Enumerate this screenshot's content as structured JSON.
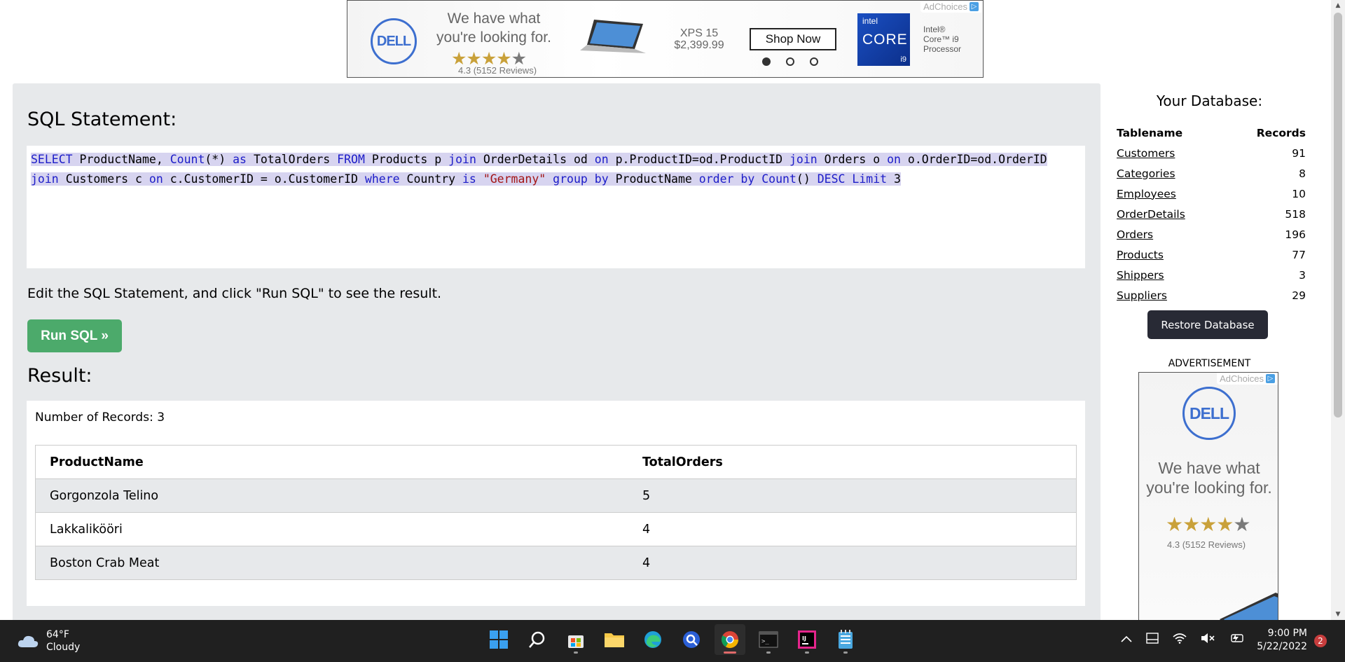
{
  "top_ad": {
    "brand": "DELL",
    "tagline_1": "We have what",
    "tagline_2": "you're looking for.",
    "rating": "4.3",
    "reviews": "(5152 Reviews)",
    "product": "XPS 15",
    "price": "$2,399.99",
    "cta": "Shop Now",
    "intel_brand": "intel",
    "intel_core": "CORE",
    "intel_tier": "i9",
    "intel_text_1": "Intel®",
    "intel_text_2": "Core™ i9",
    "intel_text_3": "Processor",
    "adchoices": "AdChoices",
    "carousel_active_index": 0,
    "carousel_count": 3
  },
  "sql_section": {
    "heading": "SQL Statement:",
    "statement": "SELECT ProductName, Count(*) as TotalOrders FROM Products p join OrderDetails od on p.ProductID=od.ProductID join Orders o on o.OrderID=od.OrderID join Customers c on c.CustomerID = o.CustomerID where Country is \"Germany\" group by ProductName order by Count() DESC Limit 3",
    "instructions": "Edit the SQL Statement, and click \"Run SQL\" to see the result.",
    "run_button": "Run SQL »"
  },
  "result": {
    "heading": "Result:",
    "count_label": "Number of Records:",
    "count_value": "3",
    "columns": [
      "ProductName",
      "TotalOrders"
    ],
    "rows": [
      [
        "Gorgonzola Telino",
        "5"
      ],
      [
        "Lakkalikööri",
        "4"
      ],
      [
        "Boston Crab Meat",
        "4"
      ]
    ]
  },
  "sidebar": {
    "title": "Your Database:",
    "col_tablename": "Tablename",
    "col_records": "Records",
    "tables": [
      {
        "name": "Customers",
        "records": "91"
      },
      {
        "name": "Categories",
        "records": "8"
      },
      {
        "name": "Employees",
        "records": "10"
      },
      {
        "name": "OrderDetails",
        "records": "518"
      },
      {
        "name": "Orders",
        "records": "196"
      },
      {
        "name": "Products",
        "records": "77"
      },
      {
        "name": "Shippers",
        "records": "3"
      },
      {
        "name": "Suppliers",
        "records": "29"
      }
    ],
    "restore_button": "Restore Database",
    "ad_label": "ADVERTISEMENT",
    "ad": {
      "brand": "DELL",
      "tagline_1": "We have what",
      "tagline_2": "you're looking for.",
      "rating": "4.3",
      "reviews": "(5152 Reviews)",
      "adchoices": "AdChoices"
    }
  },
  "taskbar": {
    "temperature": "64°F",
    "condition": "Cloudy",
    "apps": [
      "start-icon",
      "search-icon",
      "store-icon",
      "file-explorer-icon",
      "edge-icon",
      "app-icon",
      "chrome-icon",
      "terminal-icon",
      "intellij-icon",
      "notepad-icon"
    ],
    "active_app": "chrome-icon",
    "time": "9:00 PM",
    "date": "5/22/2022",
    "notifications": "2"
  },
  "colors": {
    "run_button": "#4caa6b",
    "restore_button": "#282a35",
    "panel_bg": "#e7e9eb",
    "sql_keyword": "#1c1cc8",
    "sql_string": "#a31515",
    "selection": "#d7d4f0"
  }
}
